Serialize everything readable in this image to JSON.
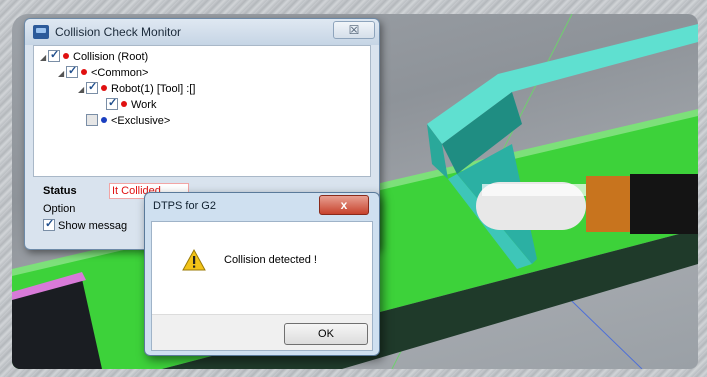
{
  "monitor": {
    "title": "Collision Check Monitor",
    "close_glyph": "☒",
    "tree": [
      {
        "label": "Collision (Root)",
        "checked": true,
        "dot": "red"
      },
      {
        "label": "<Common>",
        "checked": true,
        "dot": "red"
      },
      {
        "label": "Robot(1) [Tool] :[]",
        "checked": true,
        "dot": "red"
      },
      {
        "label": "Work",
        "checked": true,
        "dot": "red"
      },
      {
        "label": "<Exclusive>",
        "checked": false,
        "dot": "blue"
      }
    ],
    "status_label": "Status",
    "status_value": "It Collided",
    "option_label": "Option",
    "show_message_label": "Show messag"
  },
  "dialog": {
    "title": "DTPS for G2",
    "close_glyph": "x",
    "message": "Collision detected !",
    "ok_label": "OK",
    "icon": "warning-icon"
  },
  "colors": {
    "green_plate": "#3dd23a",
    "cyan_bracket": "#3ec6b8",
    "tool_orange": "#c8741e",
    "status_red": "#e01010"
  }
}
